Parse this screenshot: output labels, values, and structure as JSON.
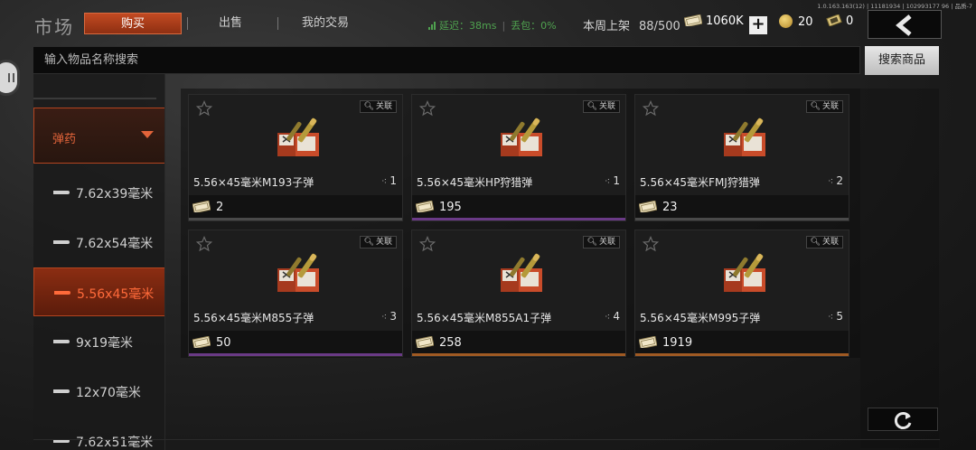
{
  "version": "1.0.163.163(12) | 11181934 | 102993177 96 | 品质-7",
  "header": {
    "title": "市场",
    "tabs": [
      {
        "label": "购买",
        "active": true
      },
      {
        "label": "出售",
        "active": false
      },
      {
        "label": "我的交易",
        "active": false
      }
    ],
    "status_latency": "延迟：38ms",
    "status_loss": "丢包：0%",
    "weekly_label": "本周上架",
    "weekly_count": "88/500",
    "cash": "1060K",
    "coins": "20",
    "tickets": "0",
    "plus_label": "+"
  },
  "search": {
    "placeholder": "输入物品名称搜索",
    "button_label": "搜索商品"
  },
  "categories": {
    "main": {
      "label": "弹药",
      "expanded": true
    },
    "items": [
      {
        "label": "7.62x39毫米",
        "active": false
      },
      {
        "label": "7.62x54毫米",
        "active": false
      },
      {
        "label": "5.56x45毫米",
        "active": true
      },
      {
        "label": "9x19毫米",
        "active": false
      },
      {
        "label": "12x70毫米",
        "active": false
      },
      {
        "label": "7.62x51毫米",
        "active": false
      }
    ]
  },
  "relation_label": "关联",
  "listings": [
    {
      "name": "5.56×45毫米M193子弹",
      "qty": "1",
      "price": "2",
      "rarity": "gray"
    },
    {
      "name": "5.56×45毫米HP狩猎弹",
      "qty": "1",
      "price": "195",
      "rarity": "purple"
    },
    {
      "name": "5.56×45毫米FMJ狩猎弹",
      "qty": "2",
      "price": "23",
      "rarity": "gray"
    },
    {
      "name": "5.56×45毫米M855子弹",
      "qty": "3",
      "price": "50",
      "rarity": "purple"
    },
    {
      "name": "5.56×45毫米M855A1子弹",
      "qty": "4",
      "price": "258",
      "rarity": "orange"
    },
    {
      "name": "5.56×45毫米M995子弹",
      "qty": "5",
      "price": "1919",
      "rarity": "orange"
    }
  ],
  "colors": {
    "accent": "#c24a22",
    "active_text": "#ff6a3a",
    "status_green": "#4fa24f",
    "purple_rarity": "#6a3a86",
    "orange_rarity": "#a05a23"
  },
  "icons": [
    "signal-icon",
    "cash-icon",
    "coin-icon",
    "ticket-icon",
    "back-arrow-icon",
    "star-icon",
    "magnifier-icon",
    "ammo-box-icon",
    "refresh-icon",
    "chevron-down-icon",
    "bullet-icon"
  ]
}
